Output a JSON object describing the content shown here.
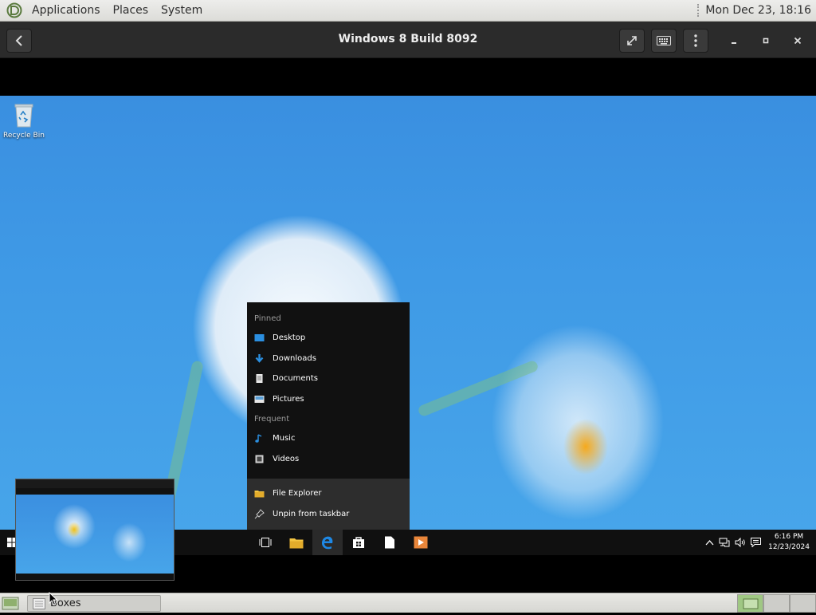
{
  "top_panel": {
    "menus": [
      "Applications",
      "Places",
      "System"
    ],
    "clock": "Mon Dec 23, 18:16"
  },
  "boxes": {
    "title": "Windows 8 Build 8092",
    "buttons": {
      "back": "back-icon",
      "fullscreen": "fullscreen-icon",
      "keyboard": "keyboard-icon",
      "menu": "kebab-menu-icon",
      "minimize": "minimize-icon",
      "maximize": "maximize-icon",
      "close": "close-icon"
    }
  },
  "desktop": {
    "recycle_bin_label": "Recycle Bin"
  },
  "jump_list": {
    "pinned_header": "Pinned",
    "pinned": [
      {
        "label": "Desktop",
        "icon": "desktop-folder-icon"
      },
      {
        "label": "Downloads",
        "icon": "downloads-icon"
      },
      {
        "label": "Documents",
        "icon": "documents-icon"
      },
      {
        "label": "Pictures",
        "icon": "pictures-icon"
      }
    ],
    "frequent_header": "Frequent",
    "frequent": [
      {
        "label": "Music",
        "icon": "music-icon"
      },
      {
        "label": "Videos",
        "icon": "videos-icon"
      }
    ],
    "tasks": [
      {
        "label": "File Explorer",
        "icon": "file-explorer-icon"
      },
      {
        "label": "Unpin from taskbar",
        "icon": "unpin-icon"
      }
    ]
  },
  "win_taskbar": {
    "apps": [
      "task-view-icon",
      "file-explorer-icon",
      "edge-icon",
      "store-icon",
      "notepad-icon",
      "media-player-icon"
    ],
    "clock_time": "6:16 PM",
    "clock_date": "12/23/2024"
  },
  "bottom_panel": {
    "task_label": "Boxes"
  },
  "colors": {
    "desktop_blue": "#3f9ae6",
    "workspace_active": "#9fc783",
    "edge_blue": "#1e88e5"
  }
}
